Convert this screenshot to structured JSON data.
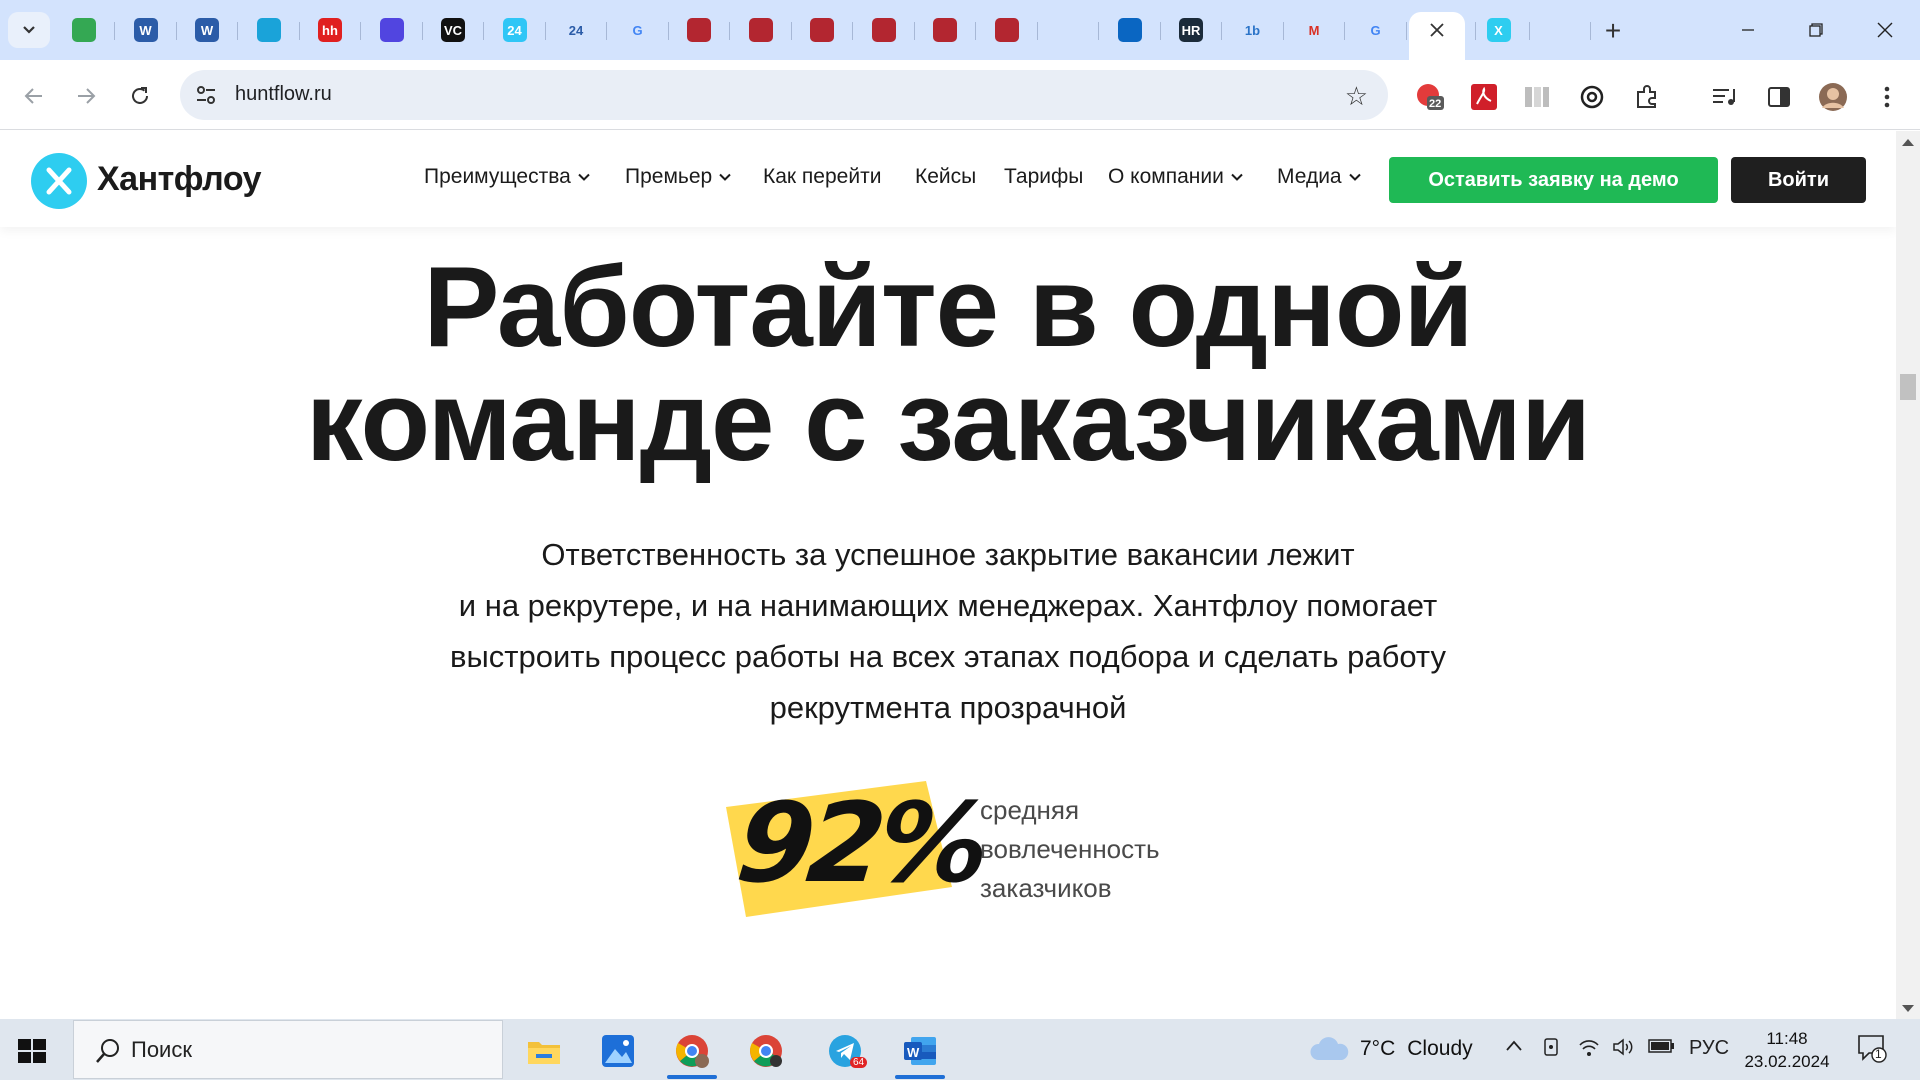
{
  "browser": {
    "tabs": [
      {
        "icon": "google-drive-icon",
        "letter": "",
        "color": "#34a853"
      },
      {
        "icon": "word-icon",
        "letter": "W",
        "color": "#2b5ca8"
      },
      {
        "icon": "word-icon",
        "letter": "W",
        "color": "#2b5ca8"
      },
      {
        "icon": "target-icon",
        "letter": "",
        "color": "#1aa3d9"
      },
      {
        "icon": "hh-icon",
        "letter": "hh",
        "color": "#e02020"
      },
      {
        "icon": "puzzle-icon",
        "letter": "",
        "color": "#5145e0"
      },
      {
        "icon": "vc-icon",
        "letter": "VC",
        "color": "#111111"
      },
      {
        "icon": "bitrix24-icon",
        "letter": "24",
        "color": "#2fc6f6"
      },
      {
        "icon": "number-24-icon",
        "letter": "24",
        "color": "#ffffff"
      },
      {
        "icon": "google-icon",
        "letter": "G",
        "color": "#ffffff"
      },
      {
        "icon": "chat-icon",
        "letter": "",
        "color": "#b32630"
      },
      {
        "icon": "chat-icon",
        "letter": "",
        "color": "#b32630"
      },
      {
        "icon": "chat-icon",
        "letter": "",
        "color": "#b32630"
      },
      {
        "icon": "chat-icon",
        "letter": "",
        "color": "#b32630"
      },
      {
        "icon": "chat-icon",
        "letter": "",
        "color": "#b32630"
      },
      {
        "icon": "chat-icon",
        "letter": "",
        "color": "#b32630"
      },
      {
        "icon": "apple-icon",
        "letter": "",
        "color": "#ffffff"
      },
      {
        "icon": "circle-icon",
        "letter": "",
        "color": "#0a66c2"
      },
      {
        "icon": "hr-icon",
        "letter": "HR",
        "color": "#1b2b3a"
      },
      {
        "icon": "1b-icon",
        "letter": "1b",
        "color": "#ffffff"
      },
      {
        "icon": "gmail-icon",
        "letter": "M",
        "color": "#ffffff"
      },
      {
        "icon": "google-icon",
        "letter": "G",
        "color": "#ffffff"
      },
      {
        "icon": "close-icon",
        "letter": "",
        "color": "#ffffff"
      },
      {
        "icon": "huntflow-icon",
        "letter": "X",
        "color": "#2ecdf0"
      },
      {
        "icon": "chart-icon",
        "letter": "",
        "color": "#ffffff"
      }
    ],
    "url": "huntflow.ru",
    "extension_badge": "22"
  },
  "site": {
    "logo_text": "Хантфлоу",
    "nav": [
      {
        "label": "Преимущества",
        "has_dropdown": true
      },
      {
        "label": "Премьер",
        "has_dropdown": true
      },
      {
        "label": "Как перейти",
        "has_dropdown": false
      },
      {
        "label": "Кейсы",
        "has_dropdown": false
      },
      {
        "label": "Тарифы",
        "has_dropdown": false
      },
      {
        "label": "О компании",
        "has_dropdown": true
      },
      {
        "label": "Медиа",
        "has_dropdown": true
      }
    ],
    "demo_button": "Оставить заявку на демо",
    "login_button": "Войти"
  },
  "hero": {
    "title_line1": "Работайте в одной",
    "title_line2": "команде с заказчиками",
    "subtitle_lines": [
      "Ответственность за успешное закрытие вакансии лежит",
      "и на рекрутере, и на нанимающих менеджерах. Хантфлоу помогает",
      "выстроить процесс работы на всех этапах подбора и сделать работу",
      "рекрутмента прозрачной"
    ],
    "stat_value": "92%",
    "stat_label_lines": [
      "средняя",
      "вовлеченность",
      "заказчиков"
    ],
    "accent_color": "#ffd84d"
  },
  "taskbar": {
    "search_placeholder": "Поиск",
    "telegram_badge": "64",
    "weather_temp": "7°C",
    "weather_text": "Cloudy",
    "language": "РУС",
    "time": "11:48",
    "date": "23.02.2024",
    "notifications": "1"
  }
}
